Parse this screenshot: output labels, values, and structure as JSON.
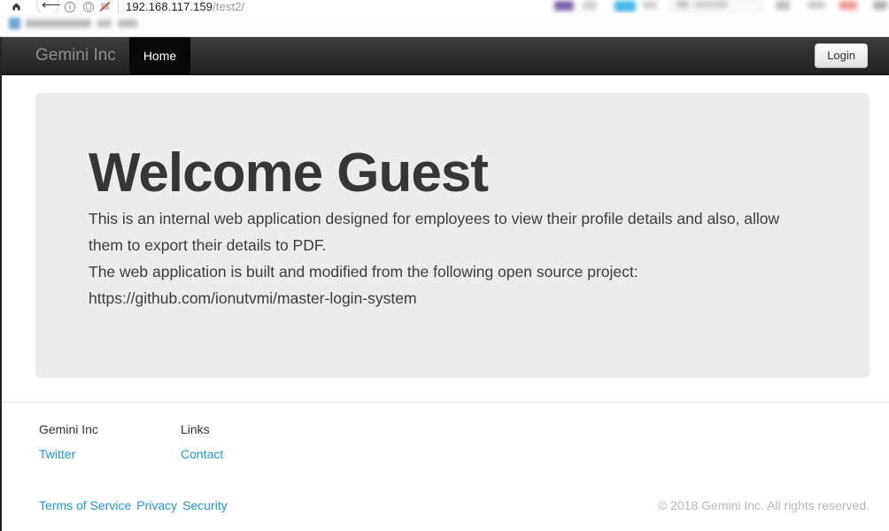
{
  "browser": {
    "url_host": "192.168.117.159",
    "url_path": "/test2/",
    "icons": {
      "home": "home-icon",
      "back": "back-arrow-icon",
      "info": "info-circle-icon",
      "shield": "shield-icon",
      "blocked": "blocked-slash-icon"
    }
  },
  "navbar": {
    "brand": "Gemini Inc",
    "links": [
      {
        "label": "Home",
        "active": true
      }
    ],
    "login_label": "Login"
  },
  "jumbotron": {
    "heading": "Welcome Guest",
    "paragraph_1": "This is an internal web application designed for employees to view their profile details and also, allow them to export their details to PDF.",
    "paragraph_2": "The web application is built and modified from the following open source project:",
    "paragraph_3": "https://github.com/ionutvmi/master-login-system"
  },
  "footer": {
    "columns": [
      {
        "title": "Gemini Inc",
        "links": [
          {
            "label": "Twitter"
          }
        ]
      },
      {
        "title": "Links",
        "links": [
          {
            "label": "Contact"
          }
        ]
      }
    ],
    "legal_links": [
      {
        "label": "Terms of Service"
      },
      {
        "label": "Privacy"
      },
      {
        "label": "Security"
      }
    ],
    "copyright": "© 2018 Gemini Inc. All rights reserved."
  },
  "colors": {
    "navbar_bg": "#222222",
    "navbar_active": "#090909",
    "jumbotron_bg": "#ececec",
    "link_blue": "#2196ea",
    "heading": "#363636",
    "copyright": "#b9b9b9"
  }
}
